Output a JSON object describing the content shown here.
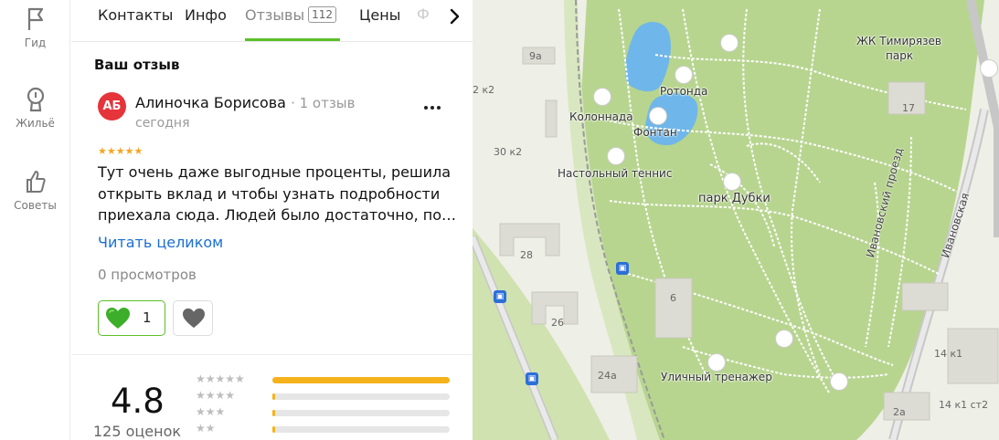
{
  "rail": {
    "items": [
      {
        "label": "Гид",
        "icon": "flag-icon"
      },
      {
        "label": "Жильё",
        "icon": "home-icon"
      },
      {
        "label": "Советы",
        "icon": "thumbs-up-icon"
      }
    ]
  },
  "tabs": {
    "items": [
      {
        "label": "Контакты"
      },
      {
        "label": "Инфо"
      },
      {
        "label": "Отзывы",
        "count": "112",
        "active": true
      },
      {
        "label": "Цены"
      }
    ],
    "faded": "Ф"
  },
  "review_section": {
    "title": "Ваш отзыв",
    "avatar_initials": "АБ",
    "author": "Алиночка Борисова",
    "author_meta": "· 1 отзыв",
    "date": "сегодня",
    "stars": "★★★★★",
    "text_lines": [
      "Тут очень даже выгодные проценты, решила",
      "открыть вклад и чтобы узнать подробности",
      "приехала сюда. Людей было достаточно, по…"
    ],
    "read_more": "Читать целиком",
    "views": "0 просмотров",
    "likes": "1"
  },
  "summary": {
    "rating": "4.8",
    "count": "125 оценок",
    "distribution": [
      {
        "stars": "★★★★★",
        "share": 1.0
      },
      {
        "stars": "★★★★",
        "share": 0.01
      },
      {
        "stars": "★★★",
        "share": 0.01
      },
      {
        "stars": "★★",
        "share": 0.01
      }
    ]
  },
  "map": {
    "labels": {
      "rotonda": "Ротонда",
      "kolonnada": "Колоннада",
      "fontan": "Фонтан",
      "tennis": "Настольный теннис",
      "park": "парк Дубки",
      "trainer": "Уличный тренажер",
      "zhk1": "ЖК Тимирязев",
      "zhk2": "парк"
    },
    "streets": {
      "ivanovsky": "Ивановский проезд",
      "ivanovskaya": "Ивановская"
    },
    "numbers": {
      "n9a": "9а",
      "n2k2": "2 к2",
      "n30k2": "30 к2",
      "n28": "28",
      "n26": "26",
      "n6": "6",
      "n24a": "24а",
      "n17": "17",
      "n14k1": "14 к1",
      "n14k1st2": "14 к1 ст2",
      "n2a": "2а"
    },
    "bus_icon": "bus-stop-icon"
  }
}
